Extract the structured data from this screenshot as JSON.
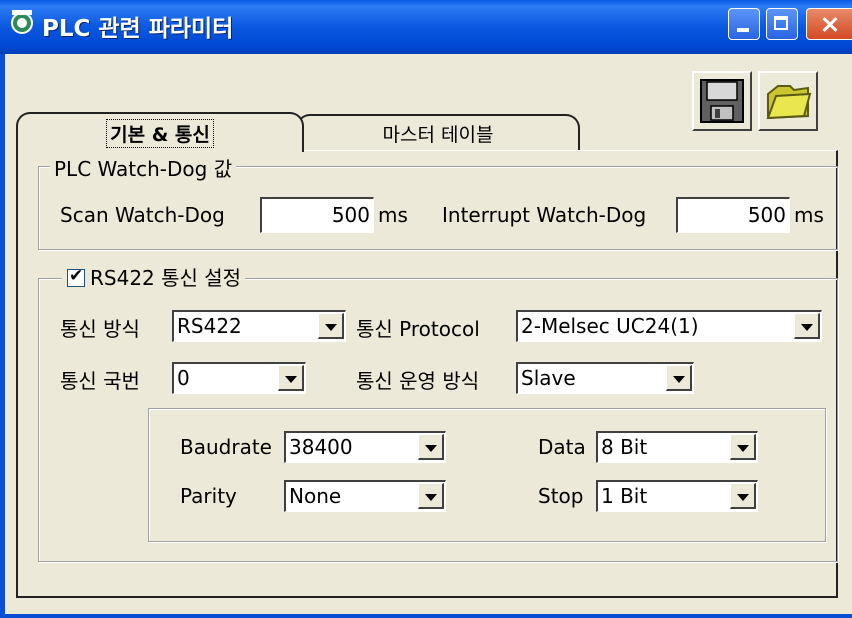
{
  "window": {
    "title": "PLC 관련 파라미터"
  },
  "tabs": [
    {
      "label": "기본 & 통신",
      "active": true
    },
    {
      "label": "마스터 테이블",
      "active": false
    }
  ],
  "watchdog": {
    "legend": "PLC Watch-Dog 값",
    "scan_label": "Scan Watch-Dog",
    "scan_value": "500",
    "scan_unit": "ms",
    "interrupt_label": "Interrupt Watch-Dog",
    "interrupt_value": "500",
    "interrupt_unit": "ms"
  },
  "rs422": {
    "legend": "RS422 통신 설정",
    "enabled": true,
    "method_label": "통신 방식",
    "method_value": "RS422",
    "protocol_label": "통신 Protocol",
    "protocol_value": "2-Melsec UC24(1)",
    "station_label": "통신 국번",
    "station_value": "0",
    "operation_label": "통신 운영 방식",
    "operation_value": "Slave",
    "baudrate_label": "Baudrate",
    "baudrate_value": "38400",
    "data_label": "Data",
    "data_value": "8 Bit",
    "parity_label": "Parity",
    "parity_value": "None",
    "stop_label": "Stop",
    "stop_value": "1 Bit"
  },
  "icons": {
    "save": "floppy-disk-icon",
    "open": "folder-icon",
    "app": "app-icon"
  },
  "colors": {
    "titlebar": "#0A58E0",
    "window_bg": "#ECE9D8",
    "close": "#D34A22"
  }
}
